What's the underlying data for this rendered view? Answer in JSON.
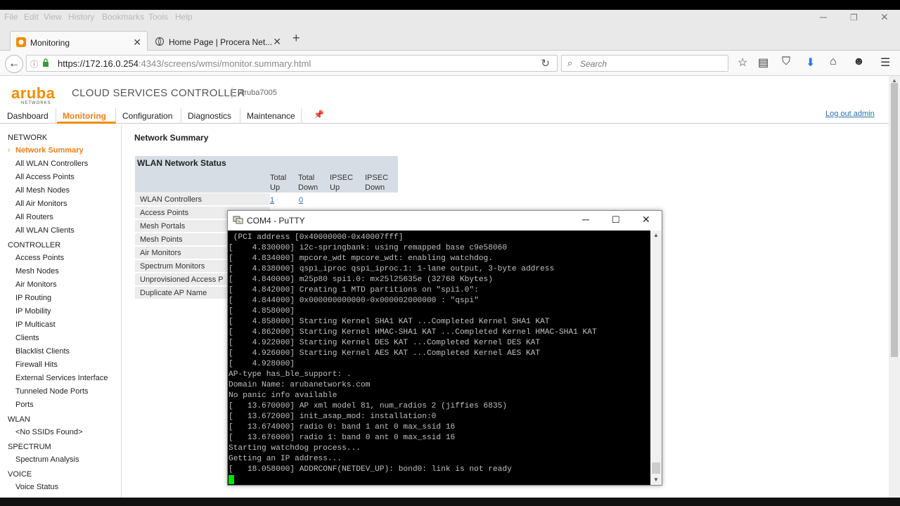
{
  "browser": {
    "menu": [
      "File",
      "Edit",
      "View",
      "History",
      "Bookmarks",
      "Tools",
      "Help"
    ],
    "tabs": [
      {
        "title": "Monitoring",
        "active": true
      },
      {
        "title": "Home Page | Procera Net...",
        "active": false
      }
    ],
    "url_host": "https://172.16.0.254",
    "url_rest": ":4343/screens/wmsi/monitor.summary.html",
    "search_placeholder": "Search"
  },
  "app": {
    "logo": "aruba",
    "logo_sub": "NETWORKS",
    "product": "CLOUD SERVICES CONTROLLER",
    "separator": "|",
    "hostname": "Aruba7005",
    "tabs": [
      "Dashboard",
      "Monitoring",
      "Configuration",
      "Diagnostics",
      "Maintenance"
    ],
    "active_tab": "Monitoring",
    "logout": "Log out admin"
  },
  "sidebar": {
    "network": {
      "title": "NETWORK",
      "items": [
        "Network Summary",
        "All WLAN Controllers",
        "All Access Points",
        "All Mesh Nodes",
        "All Air Monitors",
        "All Routers",
        "All WLAN Clients"
      ]
    },
    "controller": {
      "title": "CONTROLLER",
      "items": [
        "Access Points",
        "Mesh Nodes",
        "Air Monitors",
        "IP Routing",
        "IP Mobility",
        "IP Multicast",
        "Clients",
        "Blacklist Clients",
        "Firewall Hits",
        "External Services Interface",
        "Tunneled Node Ports",
        "Ports"
      ]
    },
    "wlan": {
      "title": "WLAN",
      "items": [
        "<No SSIDs Found>"
      ]
    },
    "spectrum": {
      "title": "SPECTRUM",
      "items": [
        "Spectrum Analysis"
      ]
    },
    "voice": {
      "title": "VOICE",
      "items": [
        "Voice Status"
      ]
    }
  },
  "content": {
    "title": "Network Summary",
    "panel_title": "WLAN Network Status",
    "columns": [
      {
        "l1": "Total",
        "l2": "Up"
      },
      {
        "l1": "Total",
        "l2": "Down"
      },
      {
        "l1": "IPSEC",
        "l2": "Up"
      },
      {
        "l1": "IPSEC",
        "l2": "Down"
      }
    ],
    "rows": [
      "WLAN Controllers",
      "Access Points",
      "Mesh Portals",
      "Mesh Points",
      "Air Monitors",
      "Spectrum Monitors",
      "Unprovisioned Access P",
      "Duplicate AP Name"
    ],
    "first_row_values": [
      "1",
      "0"
    ]
  },
  "putty": {
    "title": "COM4 - PuTTY",
    "lines": [
      " (PCI address [0x40000000-0x40007fff]",
      "[    4.830000] i2c-springbank: using remapped base c9e58060",
      "[    4.834000] mpcore_wdt mpcore_wdt: enabling watchdog.",
      "[    4.838000] qspi_iproc qspi_iproc.1: 1-lane output, 3-byte address",
      "[    4.840000] m25p80 spi1.0: mx25l25635e (32768 Kbytes)",
      "[    4.842000] Creating 1 MTD partitions on \"spi1.0\":",
      "[    4.844000] 0x000000000000-0x000002000000 : \"qspi\"",
      "[    4.858000]",
      "[    4.858000] Starting Kernel SHA1 KAT ...Completed Kernel SHA1 KAT",
      "[    4.862000] Starting Kernel HMAC-SHA1 KAT ...Completed Kernel HMAC-SHA1 KAT",
      "[    4.922000] Starting Kernel DES KAT ...Completed Kernel DES KAT",
      "[    4.926000] Starting Kernel AES KAT ...Completed Kernel AES KAT",
      "[    4.928000]",
      "AP-type has_ble_support: .",
      "Domain Name: arubanetworks.com",
      "No panic info available",
      "[   13.670000] AP xml model 81, num_radios 2 (jiffies 6835)",
      "[   13.672000] init_asap_mod: installation:0",
      "[   13.674000] radio 0: band 1 ant 0 max_ssid 16",
      "[   13.676000] radio 1: band 0 ant 0 max_ssid 16",
      "Starting watchdog process...",
      "Getting an IP address...",
      "[   18.058000] ADDRCONF(NETDEV_UP): bond0: link is not ready"
    ]
  },
  "colors": {
    "accent": "#f28c00",
    "link": "#2a6fb0",
    "cursor": "#00e000"
  }
}
